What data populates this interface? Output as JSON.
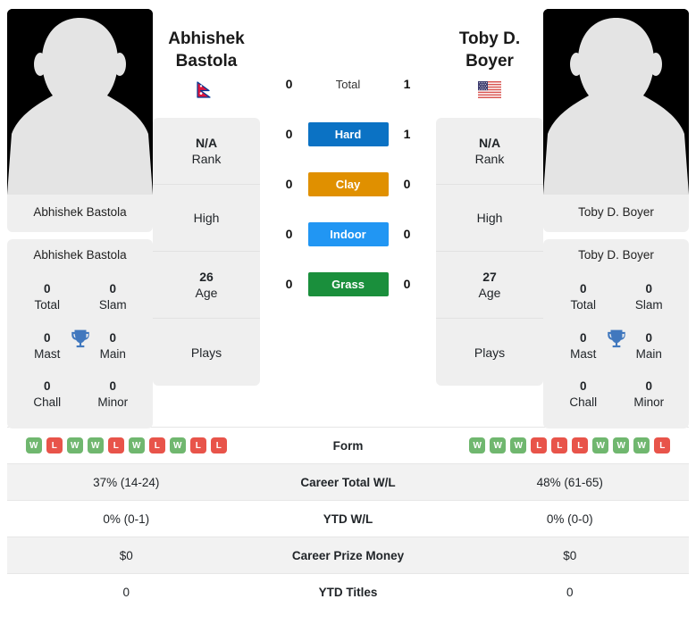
{
  "players": {
    "left": {
      "first_name": "Abhishek",
      "last_name": "Bastola",
      "photo_caption": "Abhishek Bastola",
      "flag_icon": "flag-nepal",
      "flag_alt": "Nepal",
      "rank_value": "N/A",
      "rank_label": "Rank",
      "high_label": "High",
      "high_value": "",
      "age_value": "26",
      "age_label": "Age",
      "plays_label": "Plays",
      "plays_value": "",
      "titles": {
        "total_value": "0",
        "total_label": "Total",
        "slam_value": "0",
        "slam_label": "Slam",
        "mast_value": "0",
        "mast_label": "Mast",
        "main_value": "0",
        "main_label": "Main",
        "chall_value": "0",
        "chall_label": "Chall",
        "minor_value": "0",
        "minor_label": "Minor"
      },
      "form": [
        "W",
        "L",
        "W",
        "W",
        "L",
        "W",
        "L",
        "W",
        "L",
        "L"
      ],
      "career_total_wl": "37% (14-24)",
      "ytd_wl": "0% (0-1)",
      "career_prize_money": "$0",
      "ytd_titles": "0"
    },
    "right": {
      "first_name": "Toby D.",
      "last_name": "Boyer",
      "photo_caption": "Toby D. Boyer",
      "flag_icon": "flag-usa",
      "flag_alt": "United States",
      "rank_value": "N/A",
      "rank_label": "Rank",
      "high_label": "High",
      "high_value": "",
      "age_value": "27",
      "age_label": "Age",
      "plays_label": "Plays",
      "plays_value": "",
      "titles": {
        "total_value": "0",
        "total_label": "Total",
        "slam_value": "0",
        "slam_label": "Slam",
        "mast_value": "0",
        "mast_label": "Mast",
        "main_value": "0",
        "main_label": "Main",
        "chall_value": "0",
        "chall_label": "Chall",
        "minor_value": "0",
        "minor_label": "Minor"
      },
      "form": [
        "W",
        "W",
        "W",
        "L",
        "L",
        "L",
        "W",
        "W",
        "W",
        "L"
      ],
      "career_total_wl": "48% (61-65)",
      "ytd_wl": "0% (0-0)",
      "career_prize_money": "$0",
      "ytd_titles": "0"
    }
  },
  "head_to_head": [
    {
      "label": "Total",
      "left": "0",
      "right": "1",
      "color": "",
      "style": "plain"
    },
    {
      "label": "Hard",
      "left": "0",
      "right": "1",
      "color": "#0B72C4",
      "style": "badge"
    },
    {
      "label": "Clay",
      "left": "0",
      "right": "0",
      "color": "#E09000",
      "style": "badge"
    },
    {
      "label": "Indoor",
      "left": "0",
      "right": "0",
      "color": "#2196F3",
      "style": "badge"
    },
    {
      "label": "Grass",
      "left": "0",
      "right": "0",
      "color": "#1A8F3C",
      "style": "badge"
    }
  ],
  "stats_rows": [
    {
      "label": "Form",
      "type": "form"
    },
    {
      "label": "Career Total W/L",
      "type": "text",
      "key": "career_total_wl"
    },
    {
      "label": "YTD W/L",
      "type": "text",
      "key": "ytd_wl"
    },
    {
      "label": "Career Prize Money",
      "type": "text",
      "key": "career_prize_money"
    },
    {
      "label": "YTD Titles",
      "type": "text",
      "key": "ytd_titles"
    }
  ],
  "colors": {
    "win_badge": "#70b76f",
    "loss_badge": "#e8544a",
    "trophy": "#4178be",
    "card_bg": "#efefef",
    "row_alt_bg": "#f2f2f2"
  }
}
